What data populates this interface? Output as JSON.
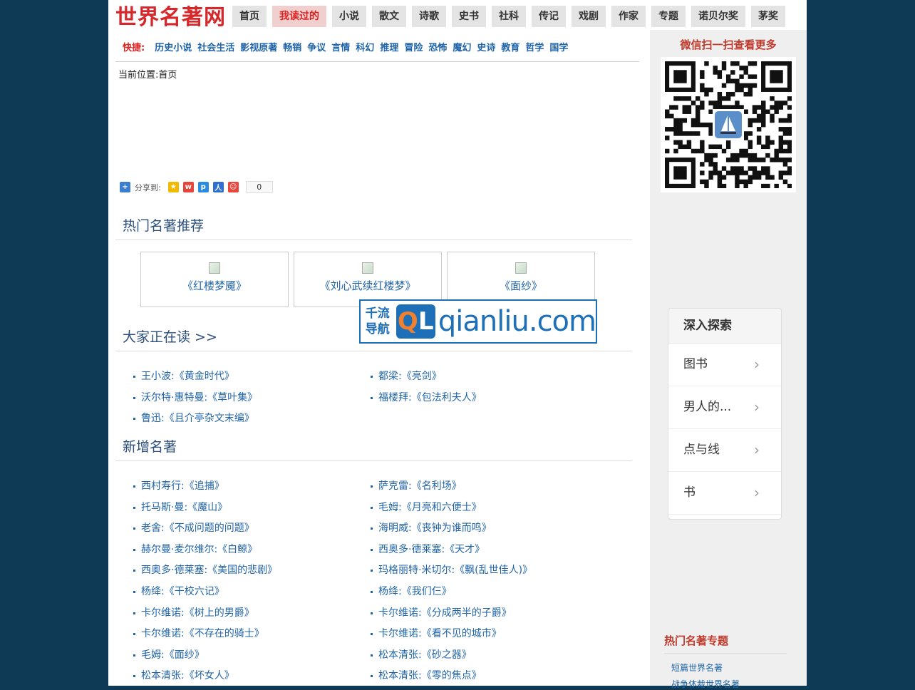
{
  "site": {
    "logo": "世界名著网"
  },
  "nav": [
    {
      "label": "首页",
      "active": false
    },
    {
      "label": "我读过的",
      "active": true
    },
    {
      "label": "小说",
      "active": false
    },
    {
      "label": "散文",
      "active": false
    },
    {
      "label": "诗歌",
      "active": false
    },
    {
      "label": "史书",
      "active": false
    },
    {
      "label": "社科",
      "active": false
    },
    {
      "label": "传记",
      "active": false
    },
    {
      "label": "戏剧",
      "active": false
    },
    {
      "label": "作家",
      "active": false
    },
    {
      "label": "专题",
      "active": false
    },
    {
      "label": "诺贝尔奖",
      "active": false
    },
    {
      "label": "茅奖",
      "active": false
    }
  ],
  "quick": {
    "label": "快捷:",
    "links": [
      "历史小说",
      "社会生活",
      "影视原著",
      "畅销",
      "争议",
      "言情",
      "科幻",
      "推理",
      "冒险",
      "恐怖",
      "魔幻",
      "史诗",
      "教育",
      "哲学",
      "国学"
    ]
  },
  "breadcrumb": {
    "prefix": "当前位置:",
    "home": "首页"
  },
  "share": {
    "label": "分享到:",
    "count": "0"
  },
  "hot": {
    "title": "热门名著推荐",
    "items": [
      "《红楼梦魇》",
      "《刘心武续红楼梦》",
      "《面纱》"
    ]
  },
  "watermark": {
    "cn_line1": "千流",
    "cn_line2": "导航",
    "logo_q": "Q",
    "logo_l": "L",
    "domain": "qianliu.com"
  },
  "reading": {
    "title": "大家正在读 >>",
    "items": [
      "王小波:《黄金时代》",
      "都梁:《亮剑》",
      "沃尔特·惠特曼:《草叶集》",
      "福楼拜:《包法利夫人》",
      "鲁迅:《且介亭杂文末编》"
    ]
  },
  "newbooks": {
    "title": "新增名著",
    "items": [
      "西村寿行:《追捕》",
      "萨克雷:《名利场》",
      "托马斯·曼:《魔山》",
      "毛姆:《月亮和六便士》",
      "老舍:《不成问题的问题》",
      "海明威:《丧钟为谁而鸣》",
      "赫尔曼·麦尔维尔:《白鲸》",
      "西奥多·德莱塞:《天才》",
      "西奥多·德莱塞:《美国的悲剧》",
      "玛格丽特·米切尔:《飘(乱世佳人)》",
      "杨绛:《干校六记》",
      "杨绛:《我们仨》",
      "卡尔维诺:《树上的男爵》",
      "卡尔维诺:《分成两半的子爵》",
      "卡尔维诺:《不存在的骑士》",
      "卡尔维诺:《看不见的城市》",
      "毛姆:《面纱》",
      "松本清张:《砂之器》",
      "松本清张:《坏女人》",
      "松本清张:《零的焦点》"
    ]
  },
  "sidebar": {
    "qr_title": "微信扫一扫查看更多",
    "explore": {
      "title": "深入探索",
      "items": [
        "图书",
        "男人的...",
        "点与线",
        "书"
      ]
    },
    "hot_topics": {
      "title": "热门名著专题",
      "items": [
        "短篇世界名著",
        "战争体裁世界名著"
      ]
    }
  },
  "colors": {
    "accent_red": "#d22222",
    "link_blue": "#1f63a8",
    "title_blue": "#2c4f7c",
    "page_bg": "#0f3a55"
  }
}
